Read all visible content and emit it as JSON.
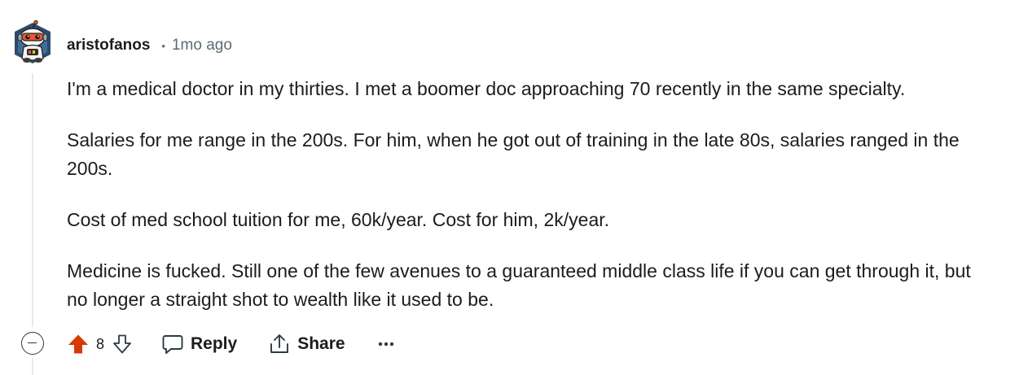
{
  "comment": {
    "author": "aristofanos",
    "separator": "•",
    "time": "1mo ago",
    "paragraphs": [
      "I'm a medical doctor in my thirties. I met a boomer doc approaching 70 recently in the same specialty.",
      "Salaries for me range in the 200s. For him, when he got out of training in the late 80s, salaries ranged in the 200s.",
      "Cost of med school tuition for me, 60k/year. Cost for him, 2k/year.",
      "Medicine is fucked. Still one of the few avenues to a guaranteed middle class life if you can get through it, but no longer a straight shot to wealth like it used to be."
    ]
  },
  "actions": {
    "score": "8",
    "reply_label": "Reply",
    "share_label": "Share",
    "more_label": "•••"
  },
  "icons": {
    "collapse": "collapse-minus-icon",
    "upvote": "upvote-arrow-icon",
    "downvote": "downvote-arrow-icon",
    "reply": "speech-bubble-icon",
    "share": "share-arrow-icon",
    "more": "ellipsis-icon"
  },
  "colors": {
    "upvote_active": "#d93a00",
    "text": "#1c1c1c",
    "meta": "#5c6c74",
    "thread_line": "#e5ebee"
  }
}
